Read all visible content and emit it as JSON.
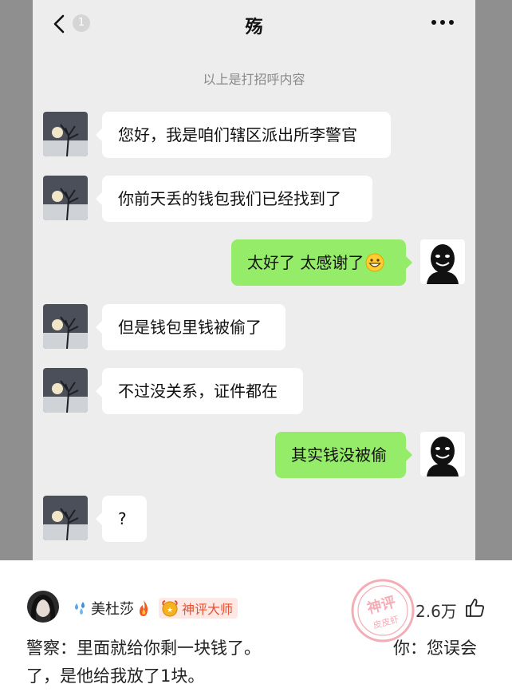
{
  "chat": {
    "badge_count": "1",
    "title": "殇",
    "notice": "以上是打招呼内容",
    "messages": [
      {
        "side": "in",
        "text": "您好，我是咱们辖区派出所李警官"
      },
      {
        "side": "in",
        "text": "你前天丢的钱包我们已经找到了"
      },
      {
        "side": "out",
        "text": "太好了 太感谢了",
        "emoji": "grinning-face-icon"
      },
      {
        "side": "in",
        "text": "但是钱包里钱被偷了"
      },
      {
        "side": "in",
        "text": "不过没关系，证件都在"
      },
      {
        "side": "out",
        "text": "其实钱没被偷"
      },
      {
        "side": "in",
        "text": "?"
      }
    ]
  },
  "comment": {
    "username": "美杜莎",
    "user_title": "神评大师",
    "stamp_text": [
      "神评",
      "皮皮虾"
    ],
    "likes": "2.6万",
    "line1_left": "警察：里面就给你剩一块钱了。",
    "line1_right": "你：您误会",
    "line2": "了，是他给我放了1块。"
  },
  "colors": {
    "outgoing_bubble": "#95ec69",
    "incoming_bubble": "#ffffff",
    "chat_background": "#ededed",
    "title_badge_text": "#e8502f"
  }
}
